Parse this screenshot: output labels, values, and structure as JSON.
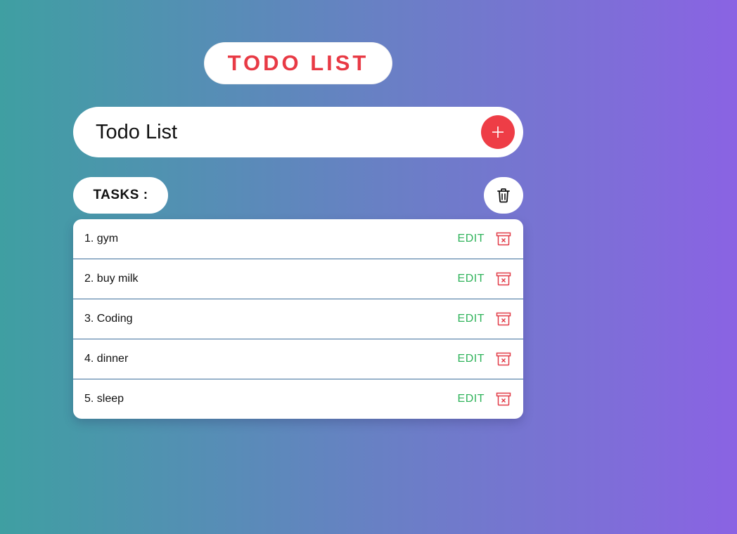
{
  "header": {
    "title": "TODO LIST"
  },
  "input": {
    "value": "Todo List",
    "add_icon": "plus-icon"
  },
  "tasks_section": {
    "label": "TASKS :",
    "clear_icon": "trash-icon"
  },
  "tasks": [
    {
      "text": "1. gym",
      "edit_label": "EDIT",
      "delete_icon": "delete-box-icon"
    },
    {
      "text": "2. buy milk",
      "edit_label": "EDIT",
      "delete_icon": "delete-box-icon"
    },
    {
      "text": "3. Coding",
      "edit_label": "EDIT",
      "delete_icon": "delete-box-icon"
    },
    {
      "text": "4. dinner",
      "edit_label": "EDIT",
      "delete_icon": "delete-box-icon"
    },
    {
      "text": "5. sleep",
      "edit_label": "EDIT",
      "delete_icon": "delete-box-icon"
    }
  ],
  "colors": {
    "accent": "#ee3d46",
    "title": "#e83a45",
    "edit": "#2fb35a",
    "gradient_start": "#3f9fa2",
    "gradient_end": "#8a63e3"
  }
}
